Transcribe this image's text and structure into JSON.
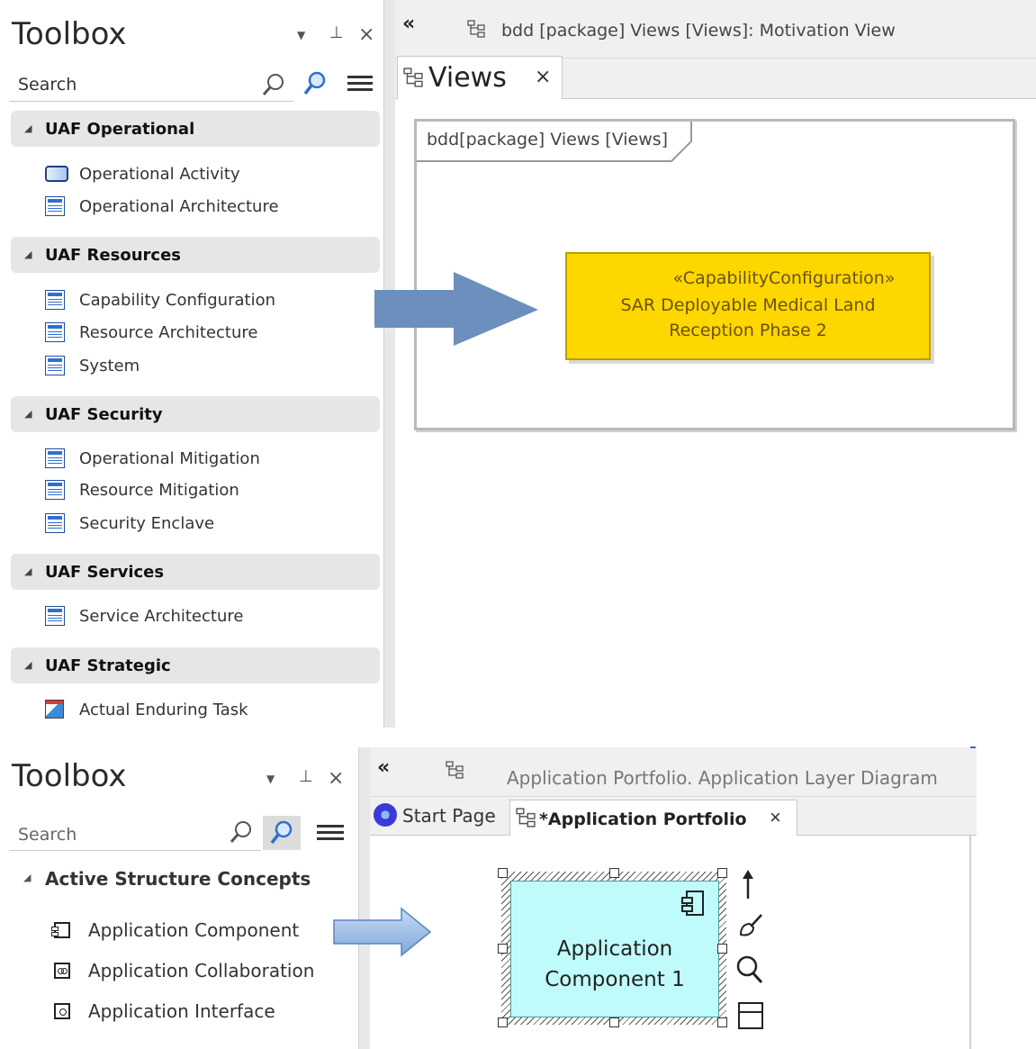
{
  "top": {
    "toolbox": {
      "title": "Toolbox",
      "search_placeholder": "Search",
      "groups": [
        {
          "label": "UAF Operational",
          "items": [
            {
              "label": "Operational Activity",
              "icon": "activity-icon"
            },
            {
              "label": "Operational Architecture",
              "icon": "block-icon"
            }
          ]
        },
        {
          "label": "UAF Resources",
          "items": [
            {
              "label": "Capability Configuration",
              "icon": "block-icon"
            },
            {
              "label": "Resource Architecture",
              "icon": "block-icon"
            },
            {
              "label": "System",
              "icon": "block-icon"
            }
          ]
        },
        {
          "label": "UAF Security",
          "items": [
            {
              "label": "Operational Mitigation",
              "icon": "block-icon"
            },
            {
              "label": "Resource Mitigation",
              "icon": "block-icon"
            },
            {
              "label": "Security Enclave",
              "icon": "block-icon"
            }
          ]
        },
        {
          "label": "UAF Services",
          "items": [
            {
              "label": "Service Architecture",
              "icon": "block-icon"
            }
          ]
        },
        {
          "label": "UAF Strategic",
          "items": [
            {
              "label": "Actual Enduring Task",
              "icon": "task-icon"
            }
          ]
        }
      ]
    },
    "header_title": "bdd [package] Views [Views]: Motivation View",
    "tab_label": "Views",
    "frame_label": "bdd[package] Views [Views]",
    "element": {
      "stereotype": "«CapabilityConfiguration»",
      "line1": "SAR Deployable Medical Land",
      "line2": "Reception Phase 2"
    }
  },
  "bottom": {
    "toolbox": {
      "title": "Toolbox",
      "search_placeholder": "Search",
      "group": "Active Structure Concepts",
      "items": [
        {
          "label": "Application Component",
          "icon": "application-component-icon"
        },
        {
          "label": "Application Collaboration",
          "icon": "application-collaboration-icon"
        },
        {
          "label": "Application Interface",
          "icon": "application-interface-icon"
        }
      ]
    },
    "header_title": "Application Portfolio.  Application Layer Diagram",
    "tabs": {
      "start": "Start Page",
      "active": "*Application Portfolio"
    },
    "element": {
      "line1": "Application",
      "line2": "Component 1"
    }
  },
  "colors": {
    "arrow": "#6d8fbd",
    "element_fill": "#ffd700",
    "component_fill": "#c0fbfb",
    "group_bg": "#e6e6e6"
  }
}
